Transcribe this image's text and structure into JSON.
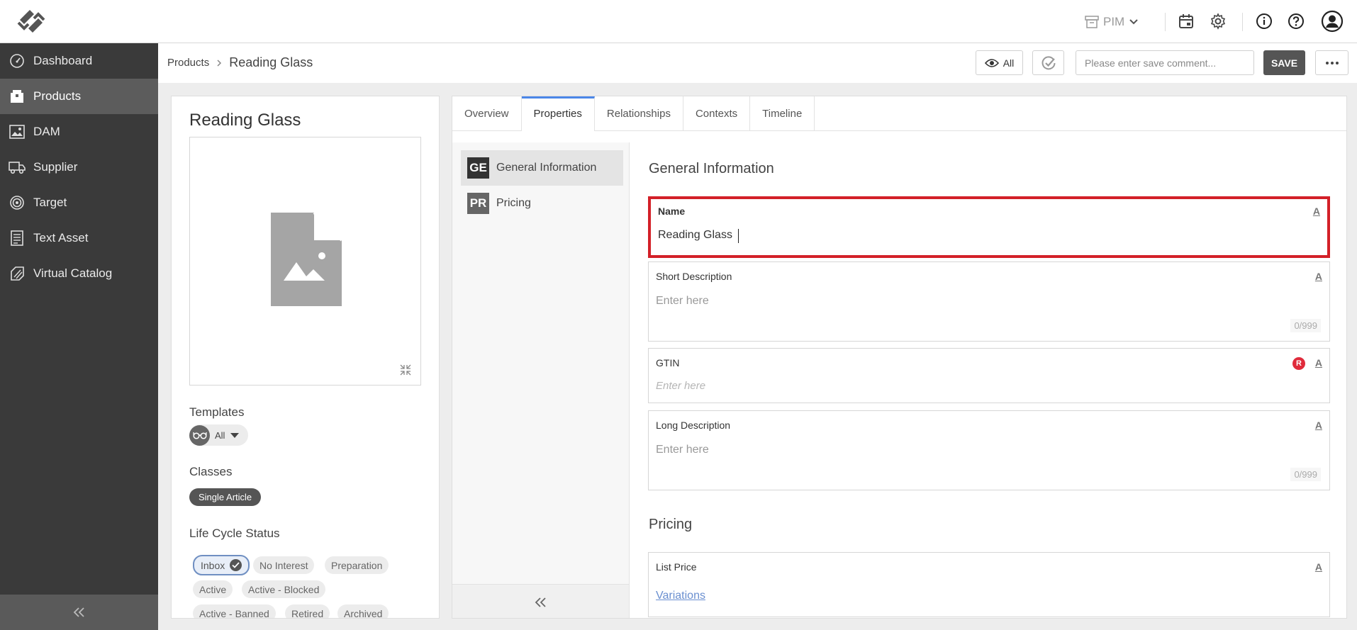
{
  "topbar": {
    "module": "PIM",
    "icons": [
      "calendar-icon",
      "gear-icon",
      "info-icon",
      "help-icon",
      "user-icon"
    ]
  },
  "sidebar": {
    "items": [
      {
        "label": "Dashboard",
        "icon": "gauge-icon"
      },
      {
        "label": "Products",
        "icon": "package-icon",
        "active": true
      },
      {
        "label": "DAM",
        "icon": "image-icon"
      },
      {
        "label": "Supplier",
        "icon": "truck-icon"
      },
      {
        "label": "Target",
        "icon": "target-icon"
      },
      {
        "label": "Text Asset",
        "icon": "document-icon"
      },
      {
        "label": "Virtual Catalog",
        "icon": "catalog-icon"
      }
    ]
  },
  "header": {
    "breadcrumb_parent": "Products",
    "breadcrumb_current": "Reading Glass",
    "view_filter": "All",
    "save_comment_placeholder": "Please enter save comment...",
    "save_label": "SAVE"
  },
  "product": {
    "title": "Reading Glass",
    "templates_label": "Templates",
    "template_value": "All",
    "classes_label": "Classes",
    "class_value": "Single Article",
    "lifecycle_label": "Life Cycle Status",
    "lifecycle": [
      "Inbox",
      "No Interest",
      "Preparation",
      "Active",
      "Active - Blocked",
      "Active - Banned",
      "Retired",
      "Archived"
    ],
    "lifecycle_selected": "Inbox"
  },
  "tabs": [
    "Overview",
    "Properties",
    "Relationships",
    "Contexts",
    "Timeline"
  ],
  "active_tab": "Properties",
  "property_groups": [
    {
      "abbr": "GE",
      "label": "General Information",
      "color": "#333333"
    },
    {
      "abbr": "PR",
      "label": "Pricing",
      "color": "#666666"
    }
  ],
  "general": {
    "title": "General Information",
    "name_label": "Name",
    "name_value": "Reading Glass",
    "short_desc_label": "Short Description",
    "short_desc_placeholder": "Enter here",
    "short_desc_counter": "0/999",
    "gtin_label": "GTIN",
    "gtin_placeholder": "Enter here",
    "gtin_required": "R",
    "long_desc_label": "Long Description",
    "long_desc_placeholder": "Enter here",
    "long_desc_counter": "0/999",
    "lang_marker": "A"
  },
  "pricing": {
    "title": "Pricing",
    "list_price_label": "List Price",
    "variations_link": "Variations",
    "lang_marker": "A"
  },
  "colors": {
    "sidebar_bg": "#3a3a3a",
    "sidebar_active": "#5c5c5c",
    "accent_tab": "#4a86e8",
    "highlight_border": "#d32028",
    "required_badge": "#e02b3b",
    "link": "#6a8fd0"
  }
}
